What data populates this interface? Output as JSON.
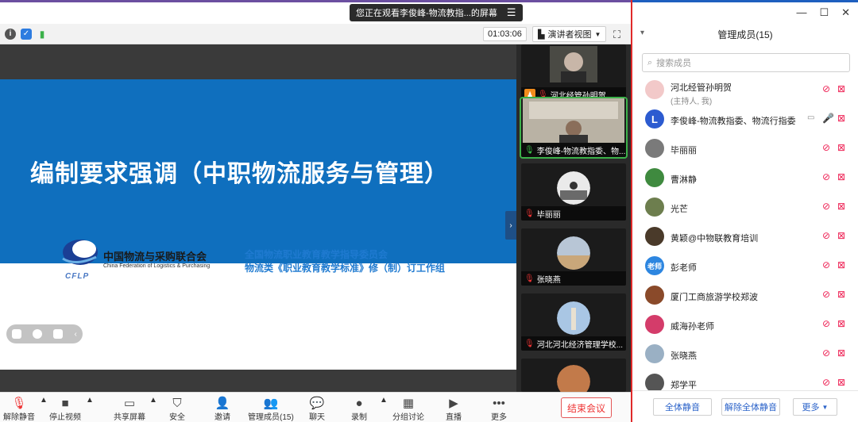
{
  "share_banner": {
    "text": "您正在观看李俊峰-物流教指...的屏幕",
    "menu_icon": "menu-icon"
  },
  "top_toolbar": {
    "timer": "01:03:06",
    "view_mode": "演讲者视图"
  },
  "slide": {
    "title": "编制要求强调（中职物流服务与管理）",
    "org_cn": "中国物流与采购联合会",
    "org_en": "China Federation of Logistics & Purchasing",
    "logo_abbr": "CFLP",
    "committee_line1": "全国物流职业教育教学指导委员会",
    "committee_line2": "物流类《职业教育教学标准》修（制）订工作组"
  },
  "gallery": [
    {
      "name": "河北经管孙明贺",
      "host": true
    },
    {
      "name": "李俊峰-物流教指委、物...",
      "active": true
    },
    {
      "name": "毕丽丽"
    },
    {
      "name": "张晓燕"
    },
    {
      "name": "河北河北经济管理学校..."
    },
    {
      "name": ""
    }
  ],
  "bottom_toolbar": {
    "items": [
      {
        "label": "解除静音",
        "icon": "mic-muted-icon"
      },
      {
        "label": "停止视频",
        "icon": "video-camera-icon"
      },
      {
        "label": "共享屏幕",
        "icon": "share-screen-icon"
      },
      {
        "label": "安全",
        "icon": "shield-icon"
      },
      {
        "label": "邀请",
        "icon": "add-person-icon"
      },
      {
        "label": "管理成员(15)",
        "icon": "participants-icon"
      },
      {
        "label": "聊天",
        "icon": "chat-icon"
      },
      {
        "label": "录制",
        "icon": "record-icon"
      },
      {
        "label": "分组讨论",
        "icon": "breakout-icon"
      },
      {
        "label": "直播",
        "icon": "live-icon"
      },
      {
        "label": "更多",
        "icon": "more-icon"
      }
    ],
    "end_meeting": "结束会议"
  },
  "panel": {
    "title": "管理成员(15)",
    "search_placeholder": "搜索成员",
    "participants": [
      {
        "name": "河北经管孙明贺",
        "sub": "(主持人, 我)",
        "avatar_color": "#f2c9c9",
        "mic": "muted"
      },
      {
        "name": "李俊峰-物流教指委、物流行指委",
        "sub": "",
        "avatar_color": "#2c5bd0",
        "avatar_letter": "L",
        "mic": "on"
      },
      {
        "name": "毕丽丽",
        "sub": "",
        "avatar_color": "#7a7a7a",
        "mic": "muted"
      },
      {
        "name": "曹淋静",
        "sub": "",
        "avatar_color": "#3f8a3f",
        "mic": "muted"
      },
      {
        "name": "光芒",
        "sub": "",
        "avatar_color": "#6d7e4e",
        "mic": "muted"
      },
      {
        "name": "黄颖@中物联教育培训",
        "sub": "",
        "avatar_color": "#4a3a2a",
        "mic": "muted"
      },
      {
        "name": "彭老师",
        "sub": "",
        "avatar_color": "#2d86e0",
        "avatar_letter": "老师",
        "mic": "muted"
      },
      {
        "name": "厦门工商旅游学校郑波",
        "sub": "",
        "avatar_color": "#8a4a2a",
        "mic": "muted"
      },
      {
        "name": "威海孙老师",
        "sub": "",
        "avatar_color": "#d43c6a",
        "mic": "muted"
      },
      {
        "name": "张晓燕",
        "sub": "",
        "avatar_color": "#9ab0c4",
        "mic": "muted"
      },
      {
        "name": "郑学平",
        "sub": "",
        "avatar_color": "#555555",
        "mic": "muted"
      }
    ],
    "footer": {
      "mute_all": "全体静音",
      "unmute_all": "解除全体静音",
      "more": "更多"
    }
  },
  "colors": {
    "accent": "#1e5fbf",
    "slide_blue": "#0f6fbe",
    "danger": "#e33333",
    "highlight_border": "#e02a2a"
  }
}
